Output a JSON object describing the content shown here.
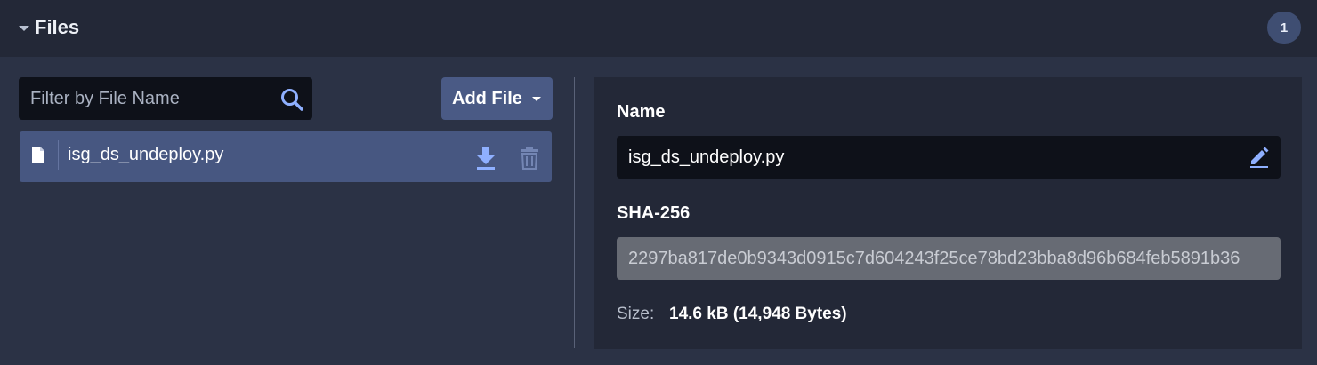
{
  "header": {
    "title": "Files",
    "count": "1"
  },
  "search": {
    "placeholder": "Filter by File Name",
    "value": ""
  },
  "toolbar": {
    "add_file_label": "Add File"
  },
  "files": [
    {
      "name": "isg_ds_undeploy.py"
    }
  ],
  "details": {
    "name_label": "Name",
    "name_value": "isg_ds_undeploy.py",
    "sha_label": "SHA-256",
    "sha_value": "2297ba817de0b9343d0915c7d604243f25ce78bd23bba8d96b684feb5891b36",
    "size_label": "Size:",
    "size_value": "14.6 kB (14,948 Bytes)"
  },
  "colors": {
    "background": "#2b3245",
    "header_bg": "#232837",
    "selected_row": "#475781",
    "accent_icon": "#8fb0ff",
    "input_bg": "#0e1119"
  },
  "icons": {
    "collapse": "caret-down-icon",
    "search": "search-icon",
    "add_file_dropdown": "caret-down-icon",
    "file": "file-icon",
    "download": "download-icon",
    "delete": "trash-icon",
    "edit": "pencil-icon"
  }
}
